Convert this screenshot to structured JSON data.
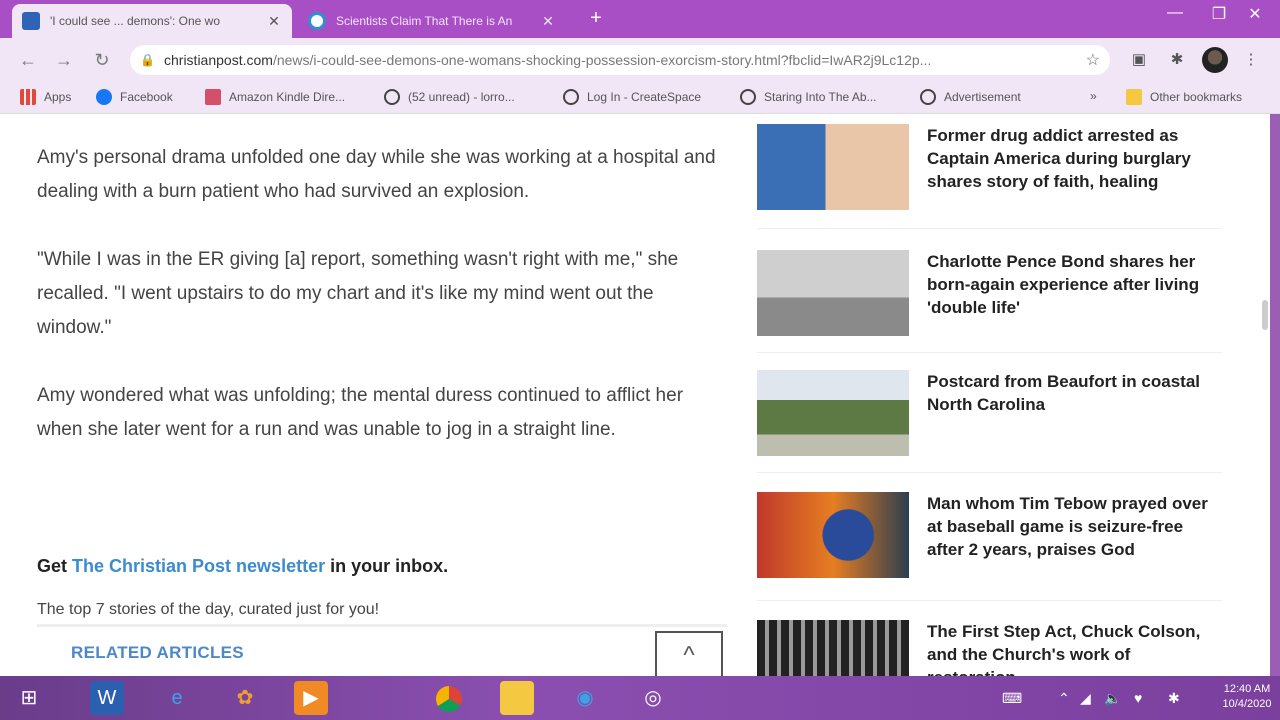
{
  "browser": {
    "tabs": [
      {
        "title": "'I could see ... demons': One wo",
        "active": true,
        "favicon": "christianpost-favicon"
      },
      {
        "title": "Scientists Claim That There is An",
        "active": false,
        "favicon": "wordpress-favicon"
      }
    ],
    "new_tab": "+",
    "url_domain": "christianpost.com",
    "url_path": "/news/i-could-see-demons-one-womans-shocking-possession-exorcism-story.html?fbclid=IwAR2j9Lc12p...",
    "bookmarks": [
      {
        "label": "Apps",
        "icon": "apps-grid-icon",
        "color": "#e04a3b"
      },
      {
        "label": "Facebook",
        "icon": "facebook-icon",
        "color": "#1877f2"
      },
      {
        "label": "Amazon Kindle Dire...",
        "icon": "kindle-icon",
        "color": "#d34f6a"
      },
      {
        "label": "(52 unread) - lorro...",
        "icon": "globe-icon",
        "color": "#444444"
      },
      {
        "label": "Log In - CreateSpace",
        "icon": "globe-icon",
        "color": "#444444"
      },
      {
        "label": "Staring Into The Ab...",
        "icon": "globe-icon",
        "color": "#444444"
      },
      {
        "label": "Advertisement",
        "icon": "globe-icon",
        "color": "#444444"
      }
    ],
    "more_bookmarks": "»",
    "other_bookmarks": "Other bookmarks"
  },
  "article": {
    "paragraphs": [
      "Amy's personal drama unfolded one day while she was working at a hospital and dealing with a burn patient who had survived an explosion.",
      "\"While I was in the ER giving [a] report, something wasn't right with me,\" she recalled. \"I went upstairs to do my chart and it's like my mind went out the window.\"",
      "Amy wondered what was unfolding; the mental duress continued to afflict her when she later went for a run and was unable to jog in a straight line."
    ],
    "newsletter_prefix": "Get",
    "newsletter_link": "The Christian Post newsletter",
    "newsletter_suffix": "in your inbox.",
    "newsletter_sub": "The top 7 stories of the day, curated just for you!",
    "related_label": "RELATED ARTICLES",
    "scroll_top_glyph": "^"
  },
  "sidebar": {
    "stories": [
      {
        "headline": "Former drug addict arrested as Captain America during burglary shares story of faith, healing"
      },
      {
        "headline": "Charlotte Pence Bond shares her born-again experience after living 'double life'"
      },
      {
        "headline": "Postcard from Beaufort in coastal North Carolina"
      },
      {
        "headline": "Man whom Tim Tebow prayed over at baseball game is seizure-free after 2 years, praises God"
      },
      {
        "headline": "The First Step Act, Chuck Colson, and the Church's work of restoration"
      }
    ]
  },
  "taskbar": {
    "time": "12:40 AM",
    "date": "10/4/2020"
  },
  "colors": {
    "tabstrip": "#a84fc6",
    "toolbar": "#f1e6f6",
    "link": "#3b8bd0",
    "related": "#4d88c8"
  }
}
